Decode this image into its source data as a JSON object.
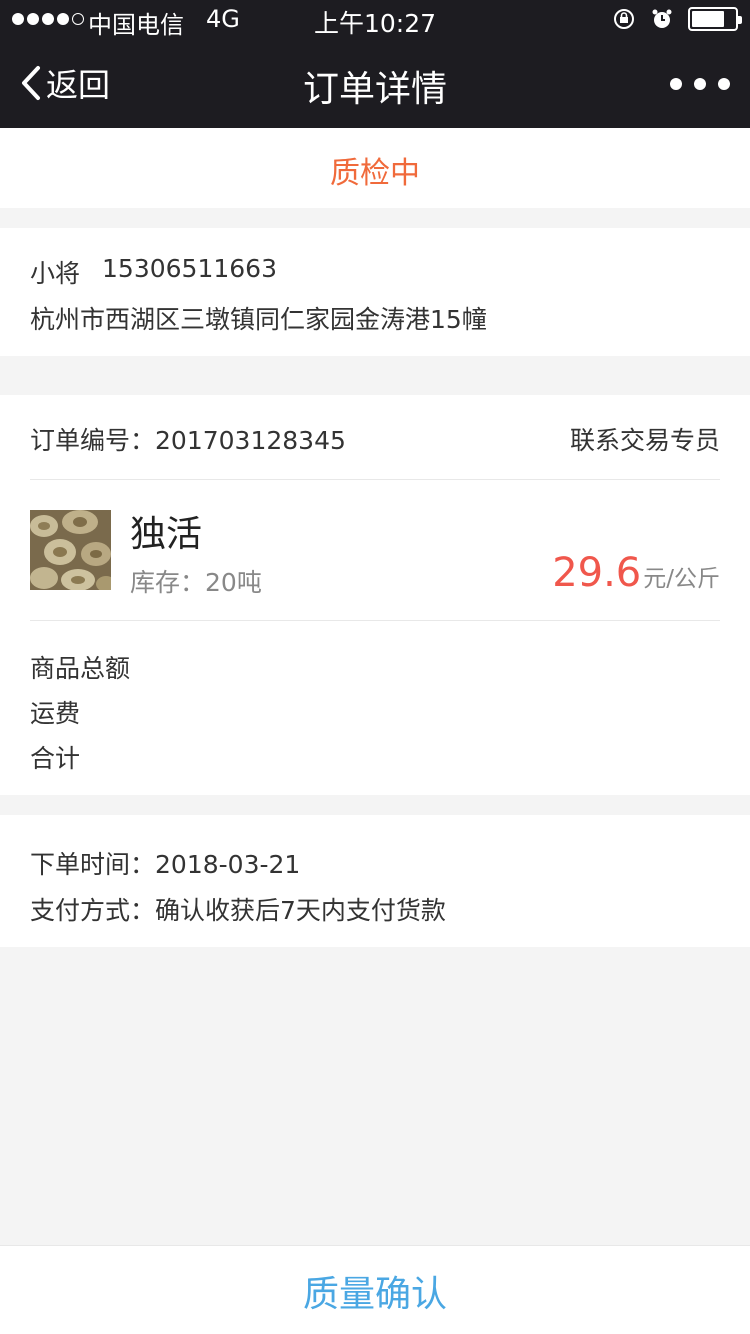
{
  "status_bar": {
    "carrier": "中国电信",
    "network": "4G",
    "time": "上午10:27",
    "signal_level": 4,
    "battery_level": 0.75
  },
  "nav": {
    "back_label": "返回",
    "title": "订单详情"
  },
  "order_status": {
    "text": "质检中",
    "color": "#f06a3b"
  },
  "recipient": {
    "name": "小将",
    "phone": "15306511663",
    "address": "杭州市西湖区三墩镇同仁家园金涛港15幢"
  },
  "order": {
    "number_label": "订单编号：",
    "number": "201703128345",
    "contact_label": "联系交易专员"
  },
  "product": {
    "name": "独活",
    "stock_label": "库存：",
    "stock": "20吨",
    "price": "29.6",
    "price_unit": "元/公斤",
    "price_color": "#f0574c",
    "image_icon": "herb-slices-image"
  },
  "summary": {
    "subtotal_label": "商品总额",
    "shipping_label": "运费",
    "total_label": "合计"
  },
  "meta": {
    "order_time_label": "下单时间：",
    "order_time": "2018-03-21",
    "payment_label": "支付方式：",
    "payment": "确认收获后7天内支付货款"
  },
  "action": {
    "confirm_label": "质量确认",
    "color": "#4aa7e3"
  }
}
